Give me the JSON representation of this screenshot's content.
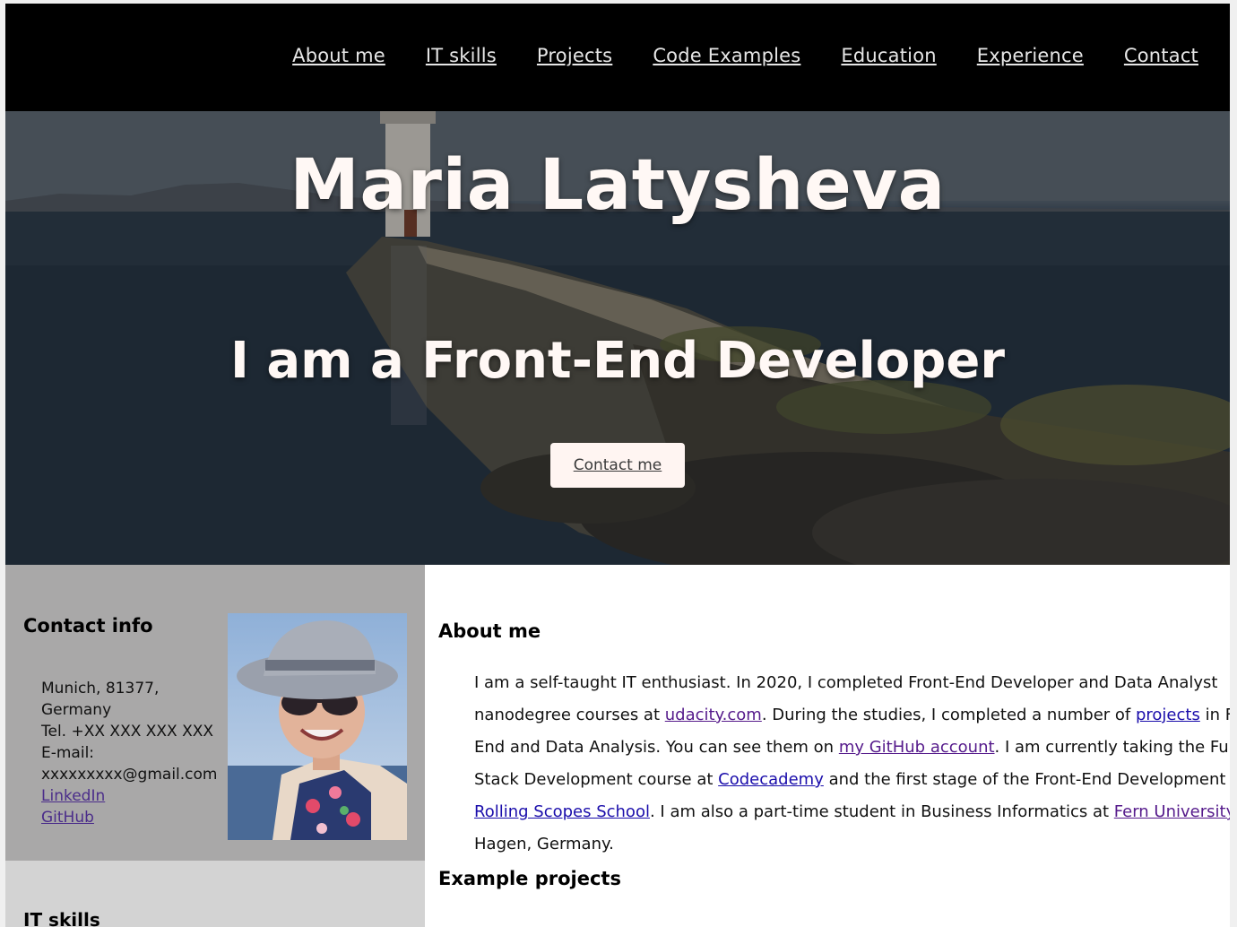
{
  "nav": {
    "items": [
      "About me",
      "IT skills",
      "Projects",
      "Code Examples",
      "Education",
      "Experience",
      "Contact"
    ]
  },
  "hero": {
    "title": "Maria Latysheva",
    "subtitle": "I am a Front-End Developer",
    "button": "Contact me"
  },
  "contact": {
    "heading": "Contact info",
    "address_line1": "Munich, 81377,",
    "address_line2": "Germany",
    "phone": "Tel. +XX XXX XXX XXX",
    "email_label": "E-mail:",
    "email": "xxxxxxxxx@gmail.com",
    "linkedin": "LinkedIn",
    "github": "GitHub"
  },
  "skills": {
    "heading": "IT skills"
  },
  "about": {
    "heading": "About me",
    "t1": "I am a self-taught IT enthusiast. In 2020, I completed Front-End Developer and Data Analyst nanodegree courses at ",
    "link_udacity": "udacity.com",
    "t2": ". During the studies, I completed a number of ",
    "link_projects": "projects",
    "t3": " in Front End and Data Analysis. You can see them on ",
    "link_github": "my GitHub account",
    "t4": ". I am currently taking the Full-Stack Development course at ",
    "link_codecademy": "Codecademy",
    "t5": " and the first stage of the Front-End Development at ",
    "link_rolling": "Rolling Scopes School",
    "t6": ". I am also a part-time student in Business Informatics at ",
    "link_fern": "Fern University",
    "t7": " in Hagen, Germany."
  },
  "projects": {
    "heading": "Example projects"
  }
}
